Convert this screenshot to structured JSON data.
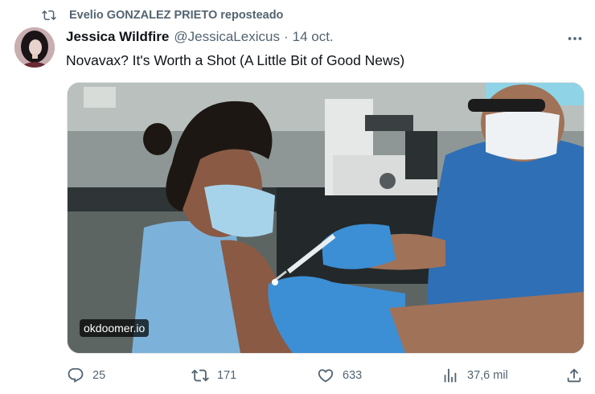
{
  "repost": {
    "icon": "repost-icon",
    "text": "Evelio GONZALEZ PRIETO reposteado"
  },
  "author": {
    "name": "Jessica Wildfire",
    "handle": "@JessicaLexicus",
    "separator": "·",
    "date": "14 oct."
  },
  "tweet": {
    "text": "Novavax? It's Worth a Shot (A Little Bit of Good News)"
  },
  "media": {
    "link_domain": "okdoomer.io"
  },
  "actions": {
    "reply_count": "25",
    "retweet_count": "171",
    "like_count": "633",
    "views_count": "37,6 mil"
  },
  "colors": {
    "secondary_text": "#536471",
    "primary_text": "#0f1419"
  }
}
